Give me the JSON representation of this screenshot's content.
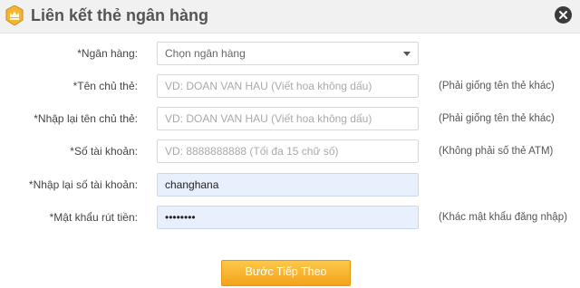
{
  "dialog": {
    "title": "Liên kết thẻ ngân hàng",
    "logo_icon": "crown-logo-icon",
    "close_icon": "close-icon"
  },
  "form": {
    "bank": {
      "label": "*Ngân hàng:",
      "value": "Chọn ngân hàng"
    },
    "holder_name": {
      "label": "*Tên chủ thẻ:",
      "placeholder": "VD: DOAN VAN HAU (Viết hoa không dấu)",
      "value": "",
      "hint": "(Phải giống tên thẻ khác)"
    },
    "holder_name_confirm": {
      "label": "*Nhập lại tên chủ thẻ:",
      "placeholder": "VD: DOAN VAN HAU (Viết hoa không dấu)",
      "value": "",
      "hint": "(Phải giống tên thẻ khác)"
    },
    "account_number": {
      "label": "*Số tài khoản:",
      "placeholder": "VD: 8888888888 (Tối đa 15 chữ số)",
      "value": "",
      "hint": "(Không phải số thẻ ATM)"
    },
    "account_number_confirm": {
      "label": "*Nhập lại số tài khoản:",
      "value": "changhana"
    },
    "withdraw_password": {
      "label": "*Mật khẩu rút tiền:",
      "value": "••••••••",
      "hint": "(Khác mật khẩu đăng nhập)"
    }
  },
  "actions": {
    "next_label": "Bước Tiếp Theo"
  },
  "colors": {
    "accent": "#f4a21b",
    "autofill": "#e8f0fe",
    "header_bg": "#f1f1f1"
  }
}
